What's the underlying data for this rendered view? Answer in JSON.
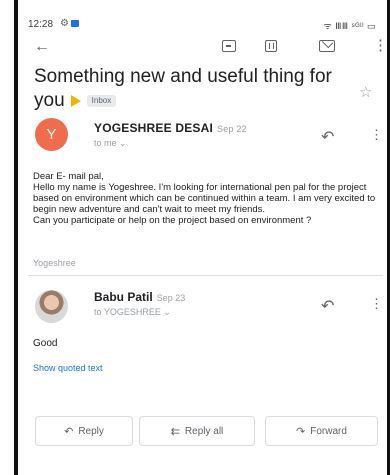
{
  "status_bar": {
    "time": "12:28",
    "right_text": "ᯤ ⅢⅢ ˢᴳˡˡ ▭"
  },
  "app_bar": {
    "back_icon": "arrow-back-icon",
    "icons": [
      "archive-icon",
      "delete-icon",
      "mail-icon",
      "more-vert-icon"
    ]
  },
  "subject": {
    "text": "Something new and useful thing for you",
    "label": "Inbox",
    "important_color": "#f4b400"
  },
  "messages": [
    {
      "avatar_letter": "Y",
      "avatar_color": "#ef6c4c",
      "sender": "YOGESHREE DESAI",
      "date": "Sep 22",
      "to": "to me",
      "body": "Dear E- mail pal,\n                    Hello my name is Yogeshree. I'm looking for international pen pal for the project based on environment which can be continued within a team. I am very excited to begin new adventure and can't wait to meet my friends.\nCan you participate or help on the project based on environment ?",
      "signature": "Yogeshree"
    },
    {
      "sender": "Babu Patil",
      "date": "Sep 23",
      "to": "to YOGESHREE",
      "body": "Good",
      "show_quoted": "Show quoted text"
    }
  ],
  "actions": {
    "reply": "Reply",
    "reply_all": "Reply all",
    "forward": "Forward"
  }
}
